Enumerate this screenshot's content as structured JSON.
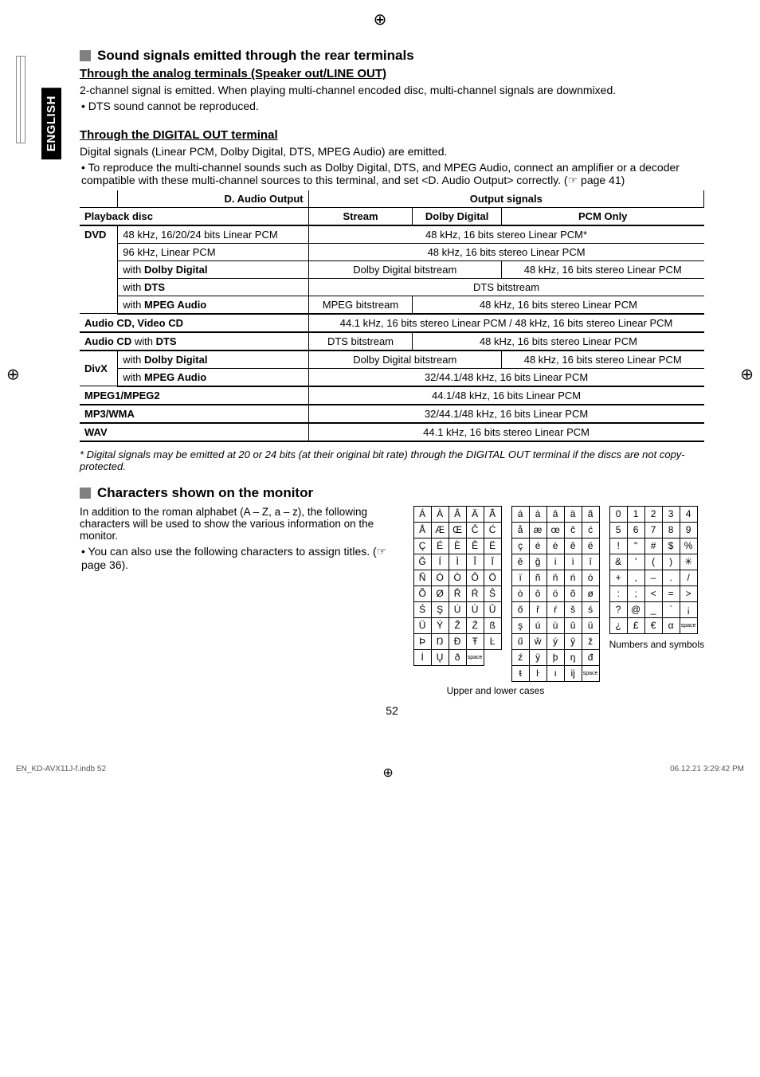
{
  "crop_mark": "⊕",
  "side_tab": "ENGLISH",
  "h1": "Sound signals emitted through the rear terminals",
  "sub1": "Through the analog terminals (Speaker out/LINE OUT)",
  "p1": "2-channel signal is emitted. When playing multi-channel encoded disc, multi-channel signals are downmixed.",
  "b1": "DTS sound cannot be reproduced.",
  "sub2": "Through the DIGITAL OUT terminal",
  "p2": "Digital signals (Linear PCM, Dolby Digital, DTS, MPEG Audio) are emitted.",
  "b2": "To reproduce the multi-channel sounds such as Dolby Digital, DTS, and MPEG Audio, connect an amplifier or a decoder compatible with these multi-channel sources to this terminal, and set <D. Audio Output> correctly. (☞ page 41)",
  "tbl": {
    "head_daudio": "D. Audio Output",
    "head_output": "Output signals",
    "head_playback": "Playback disc",
    "head_stream": "Stream",
    "head_dolby": "Dolby Digital",
    "head_pcm": "PCM Only",
    "dvd": "DVD",
    "dvd_r1a": "48 kHz, 16/20/24 bits Linear PCM",
    "dvd_r1b": "48 kHz, 16 bits stereo Linear PCM*",
    "dvd_r2a": "96 kHz, Linear PCM",
    "dvd_r2b": "48 kHz, 16 bits stereo Linear PCM",
    "with_dd": "with Dolby Digital",
    "ddbs": "Dolby Digital bitstream",
    "pcm48": "48 kHz, 16 bits stereo Linear PCM",
    "with_dts": "with DTS",
    "dtsbs": "DTS bitstream",
    "with_mpeg": "with MPEG Audio",
    "mpegbs": "MPEG bitstream",
    "acd_vcd": "Audio CD, Video CD",
    "acd_vcd_out": "44.1 kHz, 16 bits stereo Linear PCM / 48 kHz, 16 bits stereo Linear PCM",
    "acd_dts": "Audio CD with DTS",
    "divx": "DivX",
    "divx_mpeg": "32/44.1/48 kHz, 16 bits Linear PCM",
    "mpeg12": "MPEG1/MPEG2",
    "mpeg12_out": "44.1/48 kHz, 16 bits Linear PCM",
    "mp3": "MP3/WMA",
    "mp3_out": "32/44.1/48 kHz, 16 bits Linear PCM",
    "wav": "WAV",
    "wav_out": "44.1 kHz, 16 bits stereo Linear PCM"
  },
  "note": "*   Digital signals may be emitted at 20 or 24 bits (at their original bit rate) through the DIGITAL OUT terminal if the discs are not copy-protected.",
  "h2": "Characters shown on the monitor",
  "char_p": "In addition to the roman alphabet (A – Z, a – z), the following characters will be used to show the various information on the monitor.",
  "char_b": "You can also use the following characters to assign titles. (☞ page 36).",
  "chr_upper": [
    [
      "Á",
      "À",
      "Â",
      "Ä",
      "Ã"
    ],
    [
      "Å",
      "Æ",
      "Œ",
      "Č",
      "Ć"
    ],
    [
      "Ç",
      "É",
      "È",
      "Ê",
      "Ë"
    ],
    [
      "Ğ",
      "Í",
      "Ì",
      "Î",
      "Ï"
    ],
    [
      "Ñ",
      "Ó",
      "Ò",
      "Ô",
      "Ö"
    ],
    [
      "Õ",
      "Ø",
      "Ř",
      "Ŕ",
      "Ŝ"
    ],
    [
      "Ś",
      "Ş",
      "Ú",
      "Ù",
      "Û"
    ],
    [
      "Ü",
      "Ý",
      "Ž",
      "Ź",
      "ß"
    ],
    [
      "Þ",
      "Ŋ",
      "Đ",
      "Ŧ",
      "Ŀ"
    ],
    [
      "İ",
      "Ų",
      "ð",
      "space",
      ""
    ]
  ],
  "chr_lower": [
    [
      "á",
      "à",
      "â",
      "ä",
      "ã"
    ],
    [
      "å",
      "æ",
      "œ",
      "č",
      "ć"
    ],
    [
      "ç",
      "é",
      "è",
      "ê",
      "ë"
    ],
    [
      "ě",
      "ğ",
      "í",
      "ì",
      "î"
    ],
    [
      "ï",
      "ñ",
      "ň",
      "ń",
      "ó"
    ],
    [
      "ò",
      "ô",
      "ö",
      "õ",
      "ø"
    ],
    [
      "ő",
      "ř",
      "ŕ",
      "š",
      "ś"
    ],
    [
      "ş",
      "ú",
      "ù",
      "û",
      "ü"
    ],
    [
      "ű",
      "ŵ",
      "ý",
      "ŷ",
      "ž"
    ],
    [
      "ź",
      "ÿ",
      "þ",
      "ŋ",
      "đ"
    ],
    [
      "ŧ",
      "ŀ",
      "ı",
      "ĳ",
      "space"
    ]
  ],
  "chr_sym": [
    [
      "0",
      "1",
      "2",
      "3",
      "4"
    ],
    [
      "5",
      "6",
      "7",
      "8",
      "9"
    ],
    [
      "!",
      "\"",
      "#",
      "$",
      "%"
    ],
    [
      "&",
      "'",
      "(",
      ")",
      "✳"
    ],
    [
      "+",
      ",",
      "–",
      ".",
      "/"
    ],
    [
      ":",
      ";",
      "<",
      "=",
      ">"
    ],
    [
      "?",
      "@",
      "_",
      "`",
      "¡"
    ],
    [
      "¿",
      "£",
      "€",
      "α",
      "space"
    ]
  ],
  "cap_cases": "Upper and lower cases",
  "cap_ns": "Numbers and symbols",
  "page_num": "52",
  "foot_left": "EN_KD-AVX11J-f.indb   52",
  "foot_right": "06.12.21   3:29:42 PM"
}
